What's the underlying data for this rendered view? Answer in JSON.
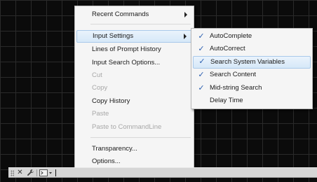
{
  "context_menu": {
    "items": [
      {
        "label": "Recent Commands",
        "submenu": true
      },
      {
        "label": "Input Settings",
        "submenu": true,
        "highlighted": true
      },
      {
        "label": "Lines of Prompt History"
      },
      {
        "label": "Input Search Options..."
      },
      {
        "label": "Cut",
        "disabled": true
      },
      {
        "label": "Copy",
        "disabled": true
      },
      {
        "label": "Copy History"
      },
      {
        "label": "Paste",
        "disabled": true
      },
      {
        "label": "Paste to CommandLine",
        "disabled": true
      },
      {
        "label": "Transparency..."
      },
      {
        "label": "Options..."
      }
    ]
  },
  "input_settings_submenu": {
    "items": [
      {
        "label": "AutoComplete",
        "checked": true
      },
      {
        "label": "AutoCorrect",
        "checked": true
      },
      {
        "label": "Search System Variables",
        "checked": true,
        "highlighted": true
      },
      {
        "label": "Search Content",
        "checked": true
      },
      {
        "label": "Mid-string Search",
        "checked": true
      },
      {
        "label": "Delay Time",
        "checked": false
      }
    ],
    "check_color": "#2b5fb0"
  },
  "command_line": {
    "close_icon": "close-icon",
    "customize_icon": "wrench-icon",
    "prompt_icon": "command-prompt-icon",
    "input_value": ""
  }
}
